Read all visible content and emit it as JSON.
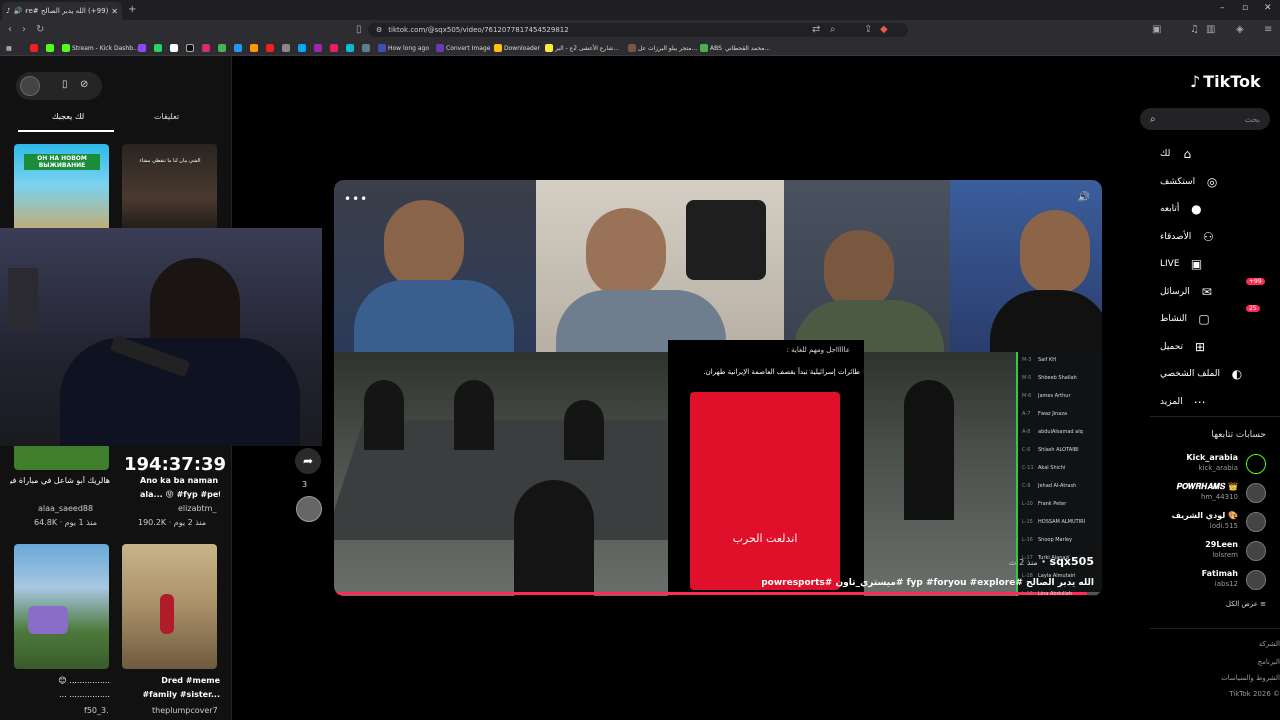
{
  "browser": {
    "tab_title": "(99+) الله يدبر الصالح #explore#",
    "url": "tiktok.com/@sqx505/video/7612077817454529812",
    "bookmarks": [
      "Stream - Kick Dashb...",
      "How long ago",
      "Convert Image",
      "Downloader",
      "شارع الأعشى 2ع - البر...",
      "متجر بيلو البرزات عل...",
      "ABS",
      "محمد القحطاني..."
    ]
  },
  "left_panel": {
    "tab_liked": "لك يعجبك",
    "tab_comments": "تعليقات",
    "thumb1_text": "ОН НА НОВОМ ВЫЖИВАНИЕ",
    "thumb2_text": "الشي يبان لنا ما تنقطي مشاء",
    "cap1": "هالريك أبو شاعل في مباراة فيها حارس مصر...",
    "user1": "alaa_saeed88",
    "meta1": "64.8K · منذ 1 يوم",
    "overlay_time": "194:37:39",
    "cap2": "Ano ka ba naman",
    "cap2b": "ala... 😝 #fyp #pet",
    "user2": "elizabtm_",
    "meta2": "190.2K · منذ 2 يوم",
    "cap3": "😊 ................",
    "cap3b": "... ................",
    "user3": "f50_3.",
    "cap4": "Dred #meme",
    "cap4b": "#family #sister...",
    "user4": "theplumpcover7"
  },
  "actions": {
    "share_count": "3"
  },
  "video": {
    "news_header": "عاااااجل ومهم للغاية :",
    "news_body": "طائرات إسرائيلية تبدأ بقصف العاصمة الإيرانية طهران.",
    "red_text": "اندلعت الحرب",
    "author": "sqx505",
    "time_ago": "منذ 2 ث",
    "caption_line": "الله يدبر الصالح #fyp #foryou #explore #ميستري_تاون #powresports",
    "progress": 0.98,
    "board": [
      {
        "n": "M-3",
        "name": "Saif KH"
      },
      {
        "n": "M-5",
        "name": "Shbeeb Shallah"
      },
      {
        "n": "M-6",
        "name": "James Arthur"
      },
      {
        "n": "A-7",
        "name": "Fwaz Jinaza"
      },
      {
        "n": "A-8",
        "name": "abdulAlsamad alq"
      },
      {
        "n": "C-6",
        "name": "Shlash ALOTAIBI"
      },
      {
        "n": "C-11",
        "name": "Akal Shichi"
      },
      {
        "n": "C-9",
        "name": "Jehad Al-Atrash"
      },
      {
        "n": "L-10",
        "name": "Frank Peter"
      },
      {
        "n": "L-15",
        "name": "HOSSAM ALMUTIRI"
      },
      {
        "n": "L-16",
        "name": "Snoop Marley"
      },
      {
        "n": "L-17",
        "name": "Turki Alanazi"
      },
      {
        "n": "L-18",
        "name": "Layla Almutairi"
      },
      {
        "n": "L-19",
        "name": "Lina Abdullah"
      }
    ]
  },
  "sidebar": {
    "logo": "TikTok",
    "search_placeholder": "بحث",
    "nav": [
      {
        "label": "لك",
        "icon": "home-icon"
      },
      {
        "label": "استكشف",
        "icon": "compass-icon"
      },
      {
        "label": "أتابعه",
        "icon": "avatar"
      },
      {
        "label": "الأصدقاء",
        "icon": "friends-icon"
      },
      {
        "label": "LIVE",
        "icon": "live-icon"
      },
      {
        "label": "الرسائل",
        "icon": "messages-icon",
        "badge": "+99"
      },
      {
        "label": "النشاط",
        "icon": "activity-icon",
        "badge": "25"
      },
      {
        "label": "تحميل",
        "icon": "upload-icon"
      },
      {
        "label": "الملف الشخصي",
        "icon": "profile-icon"
      },
      {
        "label": "المزيد",
        "icon": "more-icon"
      }
    ],
    "following_title": "حسابات تتابعها",
    "following": [
      {
        "name": "Kick_arabia",
        "handle": "kick_arabia"
      },
      {
        "name": "𝑷𝑶𝑾𝑹𝑯𝑨𝑴𝑺 👑",
        "handle": "hm_44310"
      },
      {
        "name": "لودي الشريف 🎨",
        "handle": "lodi.515"
      },
      {
        "name": "29Leen",
        "handle": "lolsrem"
      },
      {
        "name": "Fatimah",
        "handle": "iabs12"
      }
    ],
    "see_all": "عرض الكل",
    "footer": [
      "الشركة",
      "البرنامج",
      "الشروط والسياسات",
      "TikTok 2026 ©"
    ]
  }
}
